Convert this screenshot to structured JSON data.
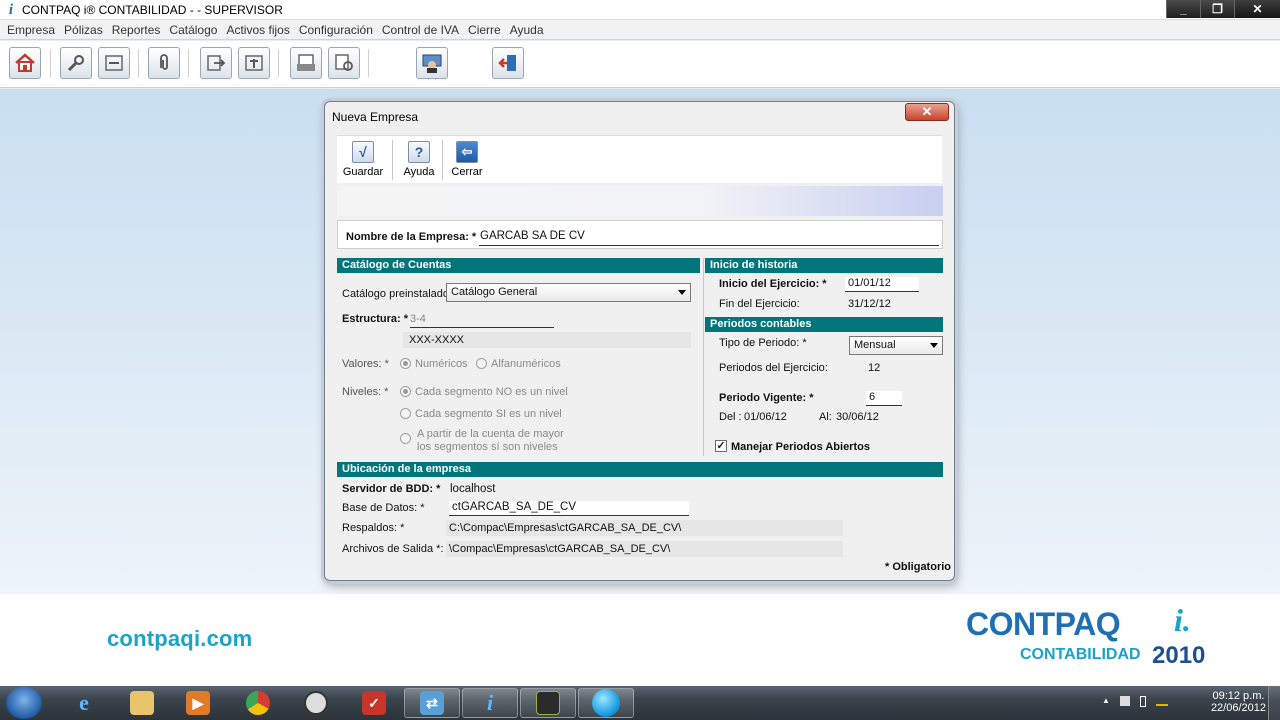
{
  "window": {
    "title": "CONTPAQ i® CONTABILIDAD -  - SUPERVISOR",
    "app_icon": "i",
    "controls": {
      "minimize": "_",
      "maximize": "❐",
      "close": "✕"
    }
  },
  "menu": [
    "Empresa",
    "Pólizas",
    "Reportes",
    "Catálogo",
    "Activos fijos",
    "Configuración",
    "Control de IVA",
    "Cierre",
    "Ayuda"
  ],
  "toolbar_icons": [
    "home-icon",
    "tools-icon",
    "minus-icon",
    "clip-icon",
    "export-icon",
    "add-icon",
    "print-icon",
    "print-preview-icon",
    "user-icon",
    "exit-icon"
  ],
  "dialog": {
    "title": "Nueva Empresa",
    "close_glyph": "✕",
    "toolbar": [
      {
        "label": "Guardar",
        "glyph": "√"
      },
      {
        "label": "Ayuda",
        "glyph": "?"
      },
      {
        "label": "Cerrar",
        "glyph": "⇦"
      }
    ],
    "name_label": "Nombre de la Empresa: *",
    "name_value": "GARCAB SA DE CV",
    "catalogo": {
      "header": "Catálogo de Cuentas",
      "preinstalado_label": "Catálogo preinstalado:",
      "preinstalado_value": "Catálogo General",
      "estructura_label": "Estructura: *",
      "estructura_value": "3-4",
      "estructura_mask": "XXX-XXXX",
      "valores_label": "Valores: *",
      "valores_opt1": "Numéricos",
      "valores_opt2": "Alfanuméricos",
      "niveles_label": "Niveles: *",
      "niveles_opt1": "Cada segmento NO es un nivel",
      "niveles_opt2": "Cada segmento SI es un nivel",
      "niveles_opt3_line1": "A partir de la cuenta de mayor",
      "niveles_opt3_line2": "los segmentos sí son niveles"
    },
    "historia": {
      "header": "Inicio de historia",
      "inicio_label": "Inicio del Ejercicio: *",
      "inicio_value": "01/01/12",
      "fin_label": "Fin del Ejercicio:",
      "fin_value": "31/12/12"
    },
    "periodos": {
      "header": "Periodos contables",
      "tipo_label": "Tipo de Periodo: *",
      "tipo_value": "Mensual",
      "periodos_label": "Periodos del Ejercicio:",
      "periodos_value": "12",
      "vigente_label": "Periodo Vigente: *",
      "vigente_value": "6",
      "del_label": "Del :",
      "del_value": "01/06/12",
      "al_label": "Al:",
      "al_value": "30/06/12",
      "abiertos_label": "Manejar Periodos Abiertos",
      "abiertos_check": "✓"
    },
    "ubicacion": {
      "header": "Ubicación de la empresa",
      "servidor_label": "Servidor de BDD: *",
      "servidor_value": "localhost",
      "base_label": "Base de Datos: *",
      "base_value": "ctGARCAB_SA_DE_CV",
      "respaldos_label": "Respaldos: *",
      "respaldos_value": "C:\\Compac\\Empresas\\ctGARCAB_SA_DE_CV\\",
      "salida_label": "Archivos de Salida *:",
      "salida_value": "\\Compac\\Empresas\\ctGARCAB_SA_DE_CV\\"
    },
    "obligatorio": "* Obligatorio"
  },
  "branding": {
    "left": "contpaqi.com",
    "main": "CONTPAQ",
    "i": "i.",
    "sub": "CONTABILIDAD",
    "year": "2010"
  },
  "taskbar": {
    "apps": [
      "explorer-icon",
      "folder-icon",
      "media-icon",
      "chrome-icon",
      "clock-app-icon",
      "todo-icon",
      "network-icon",
      "contpaq-icon",
      "tool-icon",
      "sphere-icon"
    ],
    "time": "09:12 p.m.",
    "date": "22/06/2012",
    "tray_up": "▲"
  },
  "colors": {
    "section": "#00757a",
    "brand_blue": "#1e6fb3",
    "brand_cyan": "#1aa3c8"
  }
}
